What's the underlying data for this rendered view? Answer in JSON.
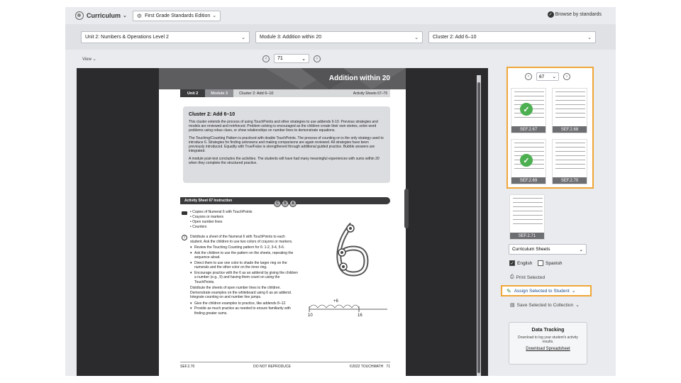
{
  "topbar": {
    "brand": "Curriculum",
    "edition": "First Grade Standards Edition",
    "browse": "Browse by standards"
  },
  "filters": {
    "unit": "Unit 2: Numbers & Operations Level 2",
    "module": "Module 3: Addition within 20",
    "cluster": "Cluster 2: Add 6–10"
  },
  "view": {
    "label": "View"
  },
  "pager": {
    "current": "71"
  },
  "page": {
    "title": "Addition within 20",
    "tabs": {
      "unit": "Unit 2",
      "module": "Module 3",
      "cluster": "Cluster 2: Add 6–10",
      "sheets": "Activity Sheets 67–79"
    },
    "cluster_heading": "Cluster 2: Add 6–10",
    "cluster_p1": "This cluster extends the process of using TouchPoints and other strategies to use addends 6-10. Previous strategies and models are reviewed and reinforced. Problem solving is encouraged as the children create their own stories, solve word problems using rebus clues, or show relationships on number lines to demonstrate equations.",
    "cluster_p2": "The Touching/Counting Pattern is practiced with double TouchPoints. The process of counting on is the only strategy used to introduce 6. Strategies for finding unknowns and making comparisons are again reviewed. All strategies have been previously introduced. Equality with True/False is strengthened through additional guided practice. Bubble answers are integrated.",
    "cluster_p3": "A module post-test concludes the activities. The students will have had many meaningful experiences with sums within 20 when they complete the structured practice.",
    "activity_title": "Activity Sheet 67 Instruction",
    "cra": [
      "C",
      "R",
      "A"
    ],
    "materials": [
      "Copies of Numeral 6 with TouchPoints",
      "Crayons or markers",
      "Open number lines",
      "Counters"
    ],
    "instr_p1": "Distribute a sheet of the Numeral 6 with TouchPoints to each student. Ask the children to use two colors of crayons or markers.",
    "instr_list1": [
      "Review the Touching Counting pattern for 6: 1-2, 3-4, 5-6.",
      "Ask the children to use the pattern on the sheets, repeating the sequence aloud.",
      "Direct them to use one color to shade the larger ring on the numerals and the other color on the inner ring.",
      "Encourage practice with the 6 as an addend by giving the children a number (e.g., 9) and having them count on using the TouchPoints."
    ],
    "instr_p2": "Distribute the sheets of open number lines to the children. Demonstrate examples on the whiteboard using 6 as an addend. Integrate counting on and number line jumps.",
    "instr_list2": [
      "Give the children examples to practice, like addends 8–12.",
      "Provide as much practice as needed to ensure familiarity with finding greater sums."
    ],
    "numberline": {
      "jump": "+6",
      "start": "10",
      "end": "16"
    },
    "footer": {
      "left": "SEF.2.70",
      "center": "DO NOT REPRODUCE",
      "right": "©2022 TOUCHMATH",
      "page": "71"
    }
  },
  "thumbnails": {
    "current": "67",
    "items": [
      {
        "label": "SEF.2.67",
        "checked": true
      },
      {
        "label": "SEF.2.68",
        "checked": false
      },
      {
        "label": "SEF.2.69",
        "checked": true
      },
      {
        "label": "SEF.2.70",
        "checked": false
      },
      {
        "label": "SEF.2.71",
        "checked": false
      }
    ]
  },
  "panel": {
    "sheets_select": "Curriculum Sheets",
    "english": "English",
    "spanish": "Spanish",
    "print": "Print Selected",
    "assign": "Assign Selected to Student",
    "save": "Save Selected to Collection"
  },
  "datatracking": {
    "title": "Data Tracking",
    "desc": "Download to log your student's activity results.",
    "link": "Download Spreadsheet"
  },
  "colors": {
    "accent": "#f0a637",
    "check": "#4caf50",
    "header": "#5d5d60"
  }
}
